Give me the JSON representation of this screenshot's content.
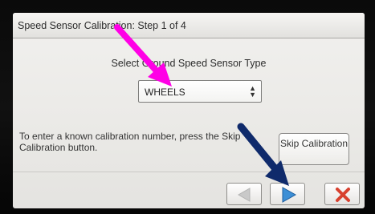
{
  "screen": {
    "title": "Speed Sensor Calibration:  Step 1 of 4",
    "prompt": "Select Ground Speed Sensor Type",
    "sensor_select": {
      "value": "WHEELS"
    },
    "info_text": "To enter a known calibration number, press the Skip Calibration button.",
    "skip_button_label": "Skip Calibration"
  },
  "nav": {
    "prev_icon": "triangle-left-icon",
    "next_icon": "triangle-right-icon",
    "cancel_icon": "x-icon"
  },
  "colors": {
    "next_arrow": "#3d8fd6",
    "prev_arrow": "#c9c9c9",
    "cancel_x": "#d8412f",
    "annotation_magenta": "#ff00e6",
    "annotation_navy": "#0f2a6b"
  }
}
